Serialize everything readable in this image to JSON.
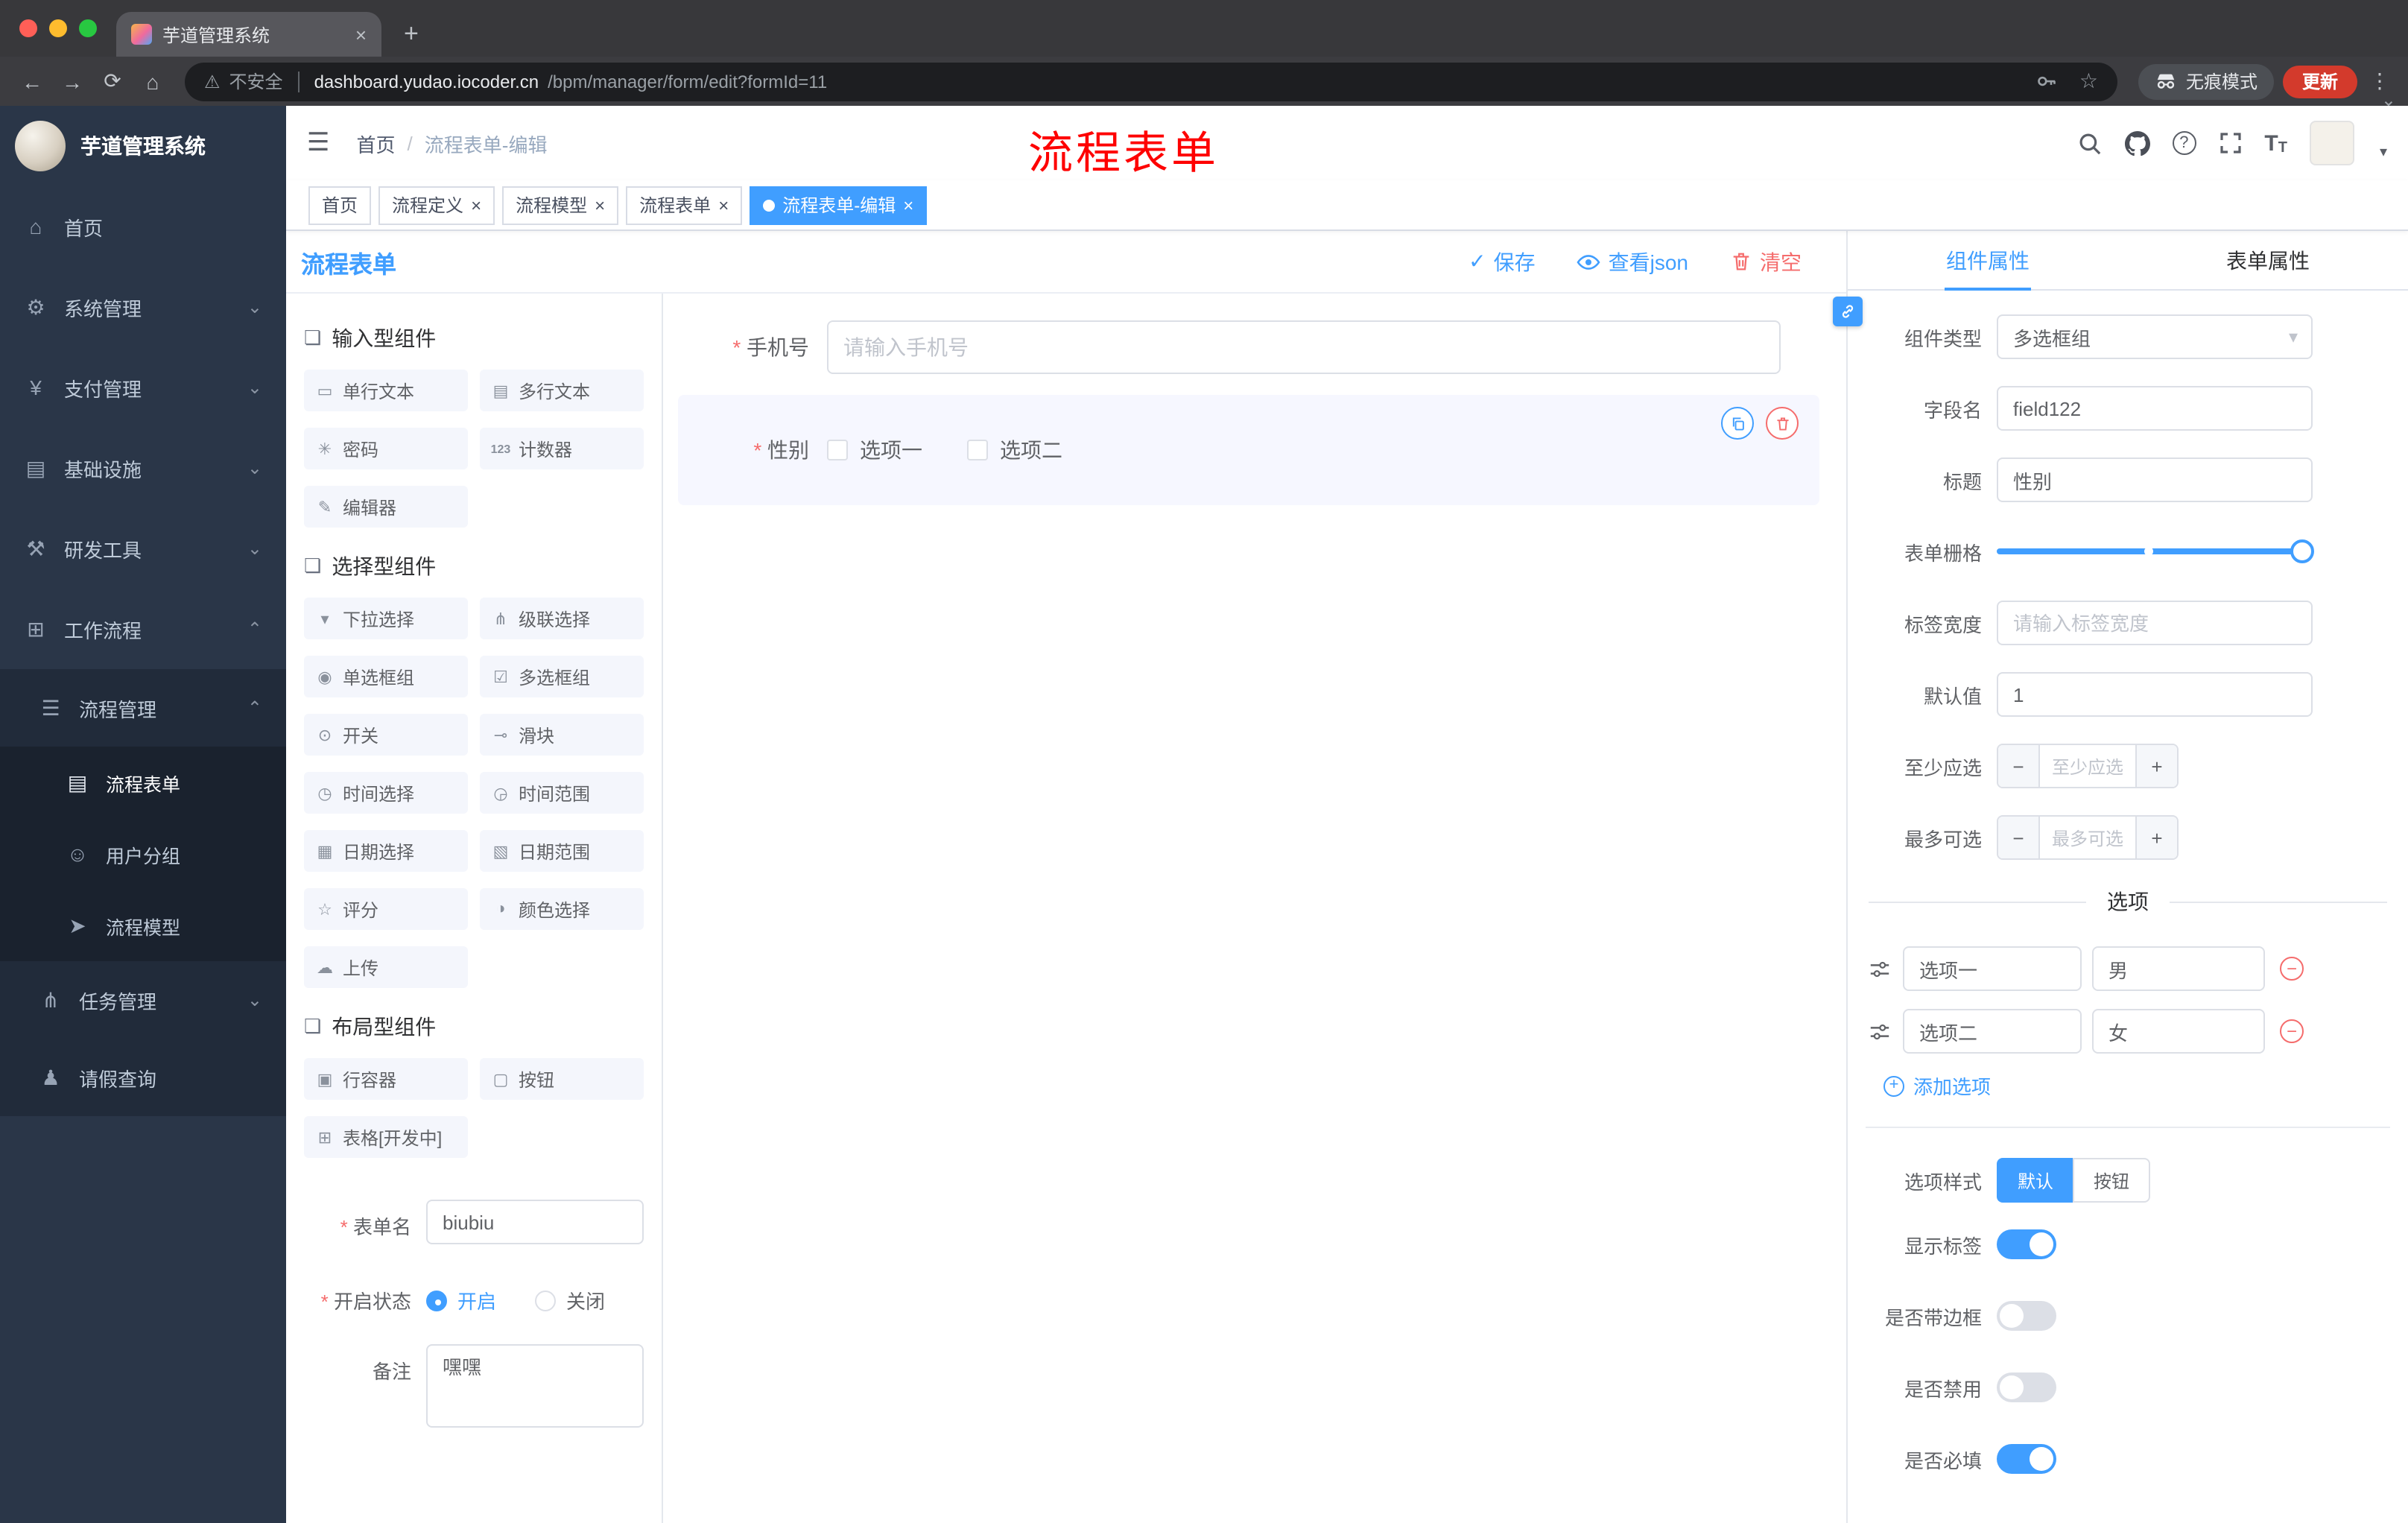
{
  "theme": {
    "primary": "#409eff",
    "danger": "#f56c6c",
    "annotation_red": "#fe0000",
    "sidebar_bg": "#2a3648",
    "tag_active_bg": "#409eff",
    "update_button_bg": "#d33a2c"
  },
  "icons": {
    "warning": "⚠",
    "hamburger": "☰",
    "back": "←",
    "forward": "→",
    "reload": "⟳",
    "home": "⌂",
    "star": "☆",
    "menu_dots": "⋮",
    "chevron_down": "⌄",
    "caret_down": "▾",
    "check": "✓",
    "close": "×",
    "plus": "+",
    "minus": "−",
    "font_size_big": "T",
    "font_size_small": "T"
  },
  "browser": {
    "tab_title": "芋道管理系统",
    "security_label": "不安全",
    "url_domain": "dashboard.yudao.iocoder.cn",
    "url_path": "/bpm/manager/form/edit?formId=11",
    "incognito_label": "无痕模式",
    "update_label": "更新"
  },
  "sidebar": {
    "logo_title": "芋道管理系统",
    "items": [
      {
        "label": "首页",
        "icon": "⌂"
      },
      {
        "label": "系统管理",
        "icon": "⚙",
        "arrow": "⌄"
      },
      {
        "label": "支付管理",
        "icon": "¥",
        "arrow": "⌄"
      },
      {
        "label": "基础设施",
        "icon": "▤",
        "arrow": "⌄"
      },
      {
        "label": "研发工具",
        "icon": "⚒",
        "arrow": "⌄"
      },
      {
        "label": "工作流程",
        "icon": "⊞",
        "arrow": "⌃"
      },
      {
        "label": "流程管理",
        "icon": "☰",
        "arrow": "⌃"
      },
      {
        "label": "流程表单",
        "icon": "▤",
        "active": true
      },
      {
        "label": "用户分组",
        "icon": "☺"
      },
      {
        "label": "流程模型",
        "icon": "➤"
      },
      {
        "label": "任务管理",
        "icon": "⋔",
        "arrow": "⌄"
      },
      {
        "label": "请假查询",
        "icon": "♟"
      }
    ]
  },
  "header": {
    "breadcrumb_home": "首页",
    "breadcrumb_sep": "/",
    "breadcrumb_current": "流程表单-编辑",
    "annotation": "流程表单"
  },
  "tags": [
    {
      "label": "首页"
    },
    {
      "label": "流程定义",
      "closable": true
    },
    {
      "label": "流程模型",
      "closable": true
    },
    {
      "label": "流程表单",
      "closable": true
    },
    {
      "label": "流程表单-编辑",
      "closable": true,
      "active": true
    }
  ],
  "designer": {
    "title": "流程表单",
    "save": "保存",
    "view_json": "查看json",
    "clear": "清空",
    "palette": {
      "sections": [
        {
          "title": "输入型组件",
          "items": [
            {
              "label": "单行文本",
              "icon": "▭"
            },
            {
              "label": "多行文本",
              "icon": "▤"
            },
            {
              "label": "密码",
              "icon": "✳"
            },
            {
              "label": "计数器",
              "icon": "123"
            },
            {
              "label": "编辑器",
              "icon": "✎"
            }
          ]
        },
        {
          "title": "选择型组件",
          "items": [
            {
              "label": "下拉选择",
              "icon": "▾"
            },
            {
              "label": "级联选择",
              "icon": "⋔"
            },
            {
              "label": "单选框组",
              "icon": "◉"
            },
            {
              "label": "多选框组",
              "icon": "☑"
            },
            {
              "label": "开关",
              "icon": "⊙"
            },
            {
              "label": "滑块",
              "icon": "⊸"
            },
            {
              "label": "时间选择",
              "icon": "◷"
            },
            {
              "label": "时间范围",
              "icon": "◶"
            },
            {
              "label": "日期选择",
              "icon": "▦"
            },
            {
              "label": "日期范围",
              "icon": "▧"
            },
            {
              "label": "评分",
              "icon": "☆"
            },
            {
              "label": "颜色选择",
              "icon": "◑"
            },
            {
              "label": "上传",
              "icon": "☁"
            }
          ]
        },
        {
          "title": "布局型组件",
          "items": [
            {
              "label": "行容器",
              "icon": "▣"
            },
            {
              "label": "按钮",
              "icon": "▢"
            },
            {
              "label": "表格[开发中]",
              "icon": "⊞"
            }
          ]
        }
      ]
    },
    "config": {
      "form_name_label": "表单名",
      "form_name_value": "biubiu",
      "status_label": "开启状态",
      "status_on": "开启",
      "status_on_selected": true,
      "status_off": "关闭",
      "remark_label": "备注",
      "remark_value": "嘿嘿"
    },
    "canvas": {
      "phone_label": "手机号",
      "phone_placeholder": "请输入手机号",
      "gender_label": "性别",
      "gender_options": [
        "选项一",
        "选项二"
      ]
    }
  },
  "props": {
    "tab_component": "组件属性",
    "tab_form": "表单属性",
    "rows": {
      "type_label": "组件类型",
      "type_value": "多选框组",
      "field_label": "字段名",
      "field_value": "field122",
      "title_label": "标题",
      "title_value": "性别",
      "grid_label": "表单栅格",
      "width_label": "标签宽度",
      "width_placeholder": "请输入标签宽度",
      "default_label": "默认值",
      "default_value": "1",
      "min_label": "至少应选",
      "min_placeholder": "至少应选",
      "max_label": "最多可选",
      "max_placeholder": "最多可选"
    },
    "options_title": "选项",
    "options": [
      {
        "label": "选项一",
        "value": "男"
      },
      {
        "label": "选项二",
        "value": "女"
      }
    ],
    "add_option": "添加选项",
    "style_label": "选项样式",
    "style_default": "默认",
    "style_default_active": true,
    "style_button": "按钮",
    "switches": [
      {
        "label": "显示标签",
        "on": true
      },
      {
        "label": "是否带边框",
        "on": false
      },
      {
        "label": "是否禁用",
        "on": false
      },
      {
        "label": "是否必填",
        "on": true
      }
    ]
  }
}
